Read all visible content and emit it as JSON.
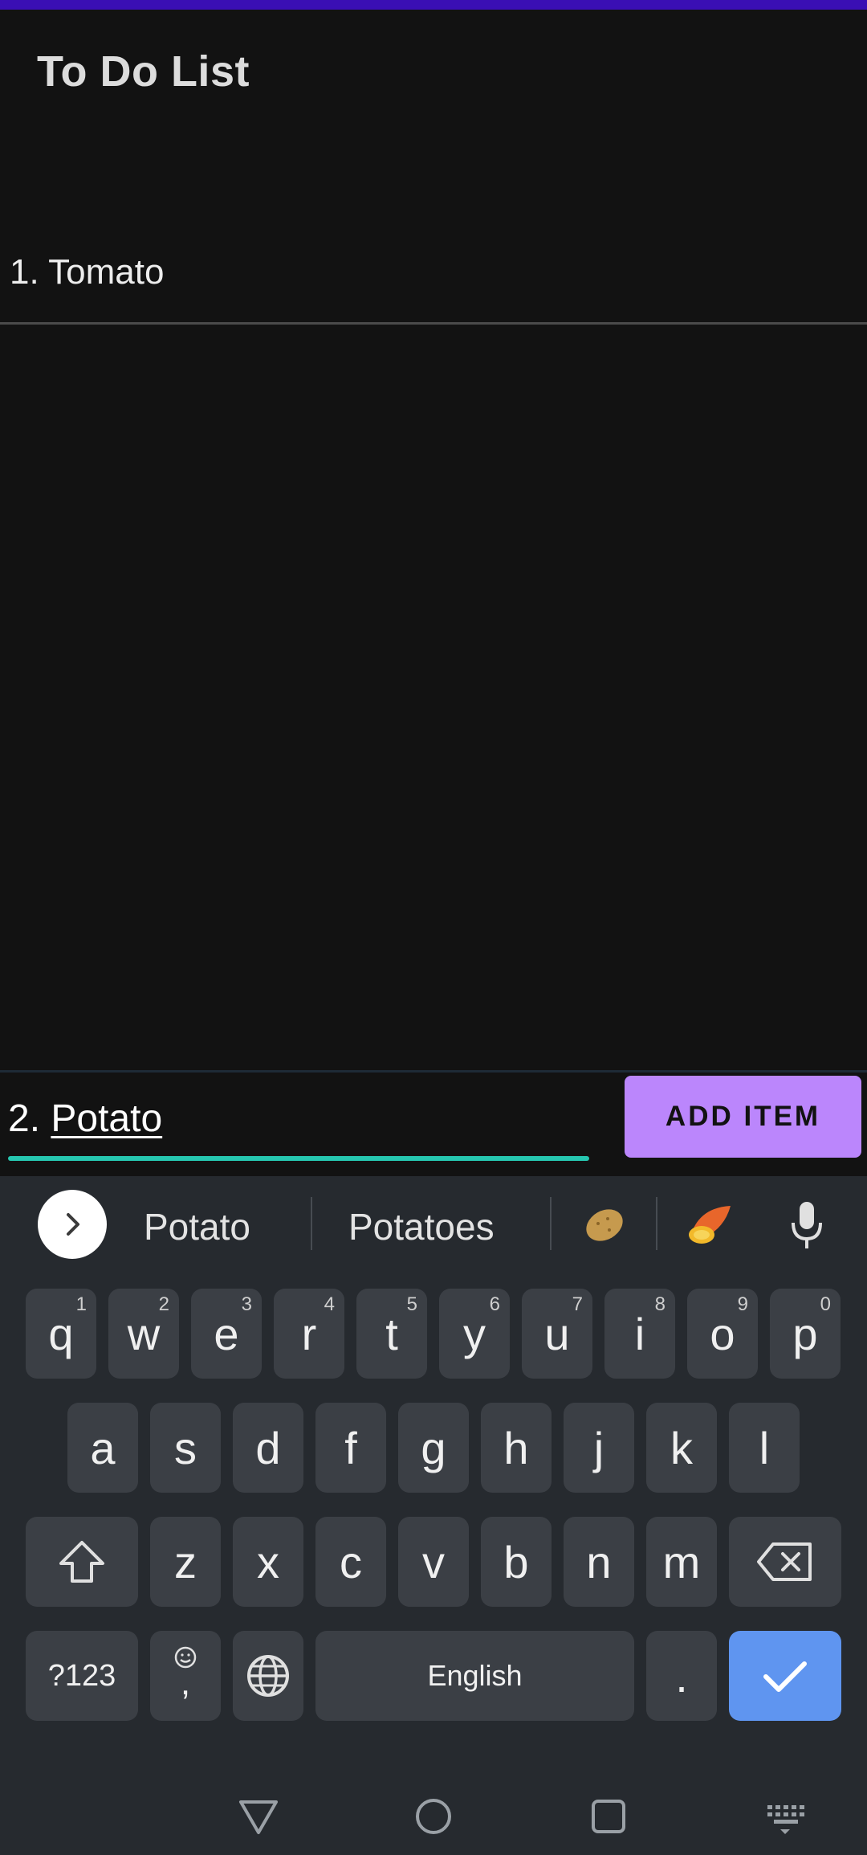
{
  "app": {
    "title": "To Do List"
  },
  "list": {
    "items": [
      {
        "label": "1. Tomato"
      }
    ]
  },
  "input": {
    "prefix": "2. ",
    "typed": "Potato"
  },
  "add_button": {
    "label": "ADD ITEM"
  },
  "keyboard": {
    "suggestions": [
      "Potato",
      "Potatoes"
    ],
    "emoji_suggestions": [
      "potato-emoji",
      "sweet-potato-emoji"
    ],
    "row1": [
      {
        "k": "q",
        "h": "1"
      },
      {
        "k": "w",
        "h": "2"
      },
      {
        "k": "e",
        "h": "3"
      },
      {
        "k": "r",
        "h": "4"
      },
      {
        "k": "t",
        "h": "5"
      },
      {
        "k": "y",
        "h": "6"
      },
      {
        "k": "u",
        "h": "7"
      },
      {
        "k": "i",
        "h": "8"
      },
      {
        "k": "o",
        "h": "9"
      },
      {
        "k": "p",
        "h": "0"
      }
    ],
    "row2": [
      "a",
      "s",
      "d",
      "f",
      "g",
      "h",
      "j",
      "k",
      "l"
    ],
    "row3": [
      "z",
      "x",
      "c",
      "v",
      "b",
      "n",
      "m"
    ],
    "symbols_label": "?123",
    "comma_label": ",",
    "space_label": "English",
    "period_label": "."
  },
  "colors": {
    "accent_purple": "#bb86fc",
    "status_bar": "#3a0fb4",
    "input_underline": "#26c6b0",
    "enter_key": "#5f95f0"
  }
}
